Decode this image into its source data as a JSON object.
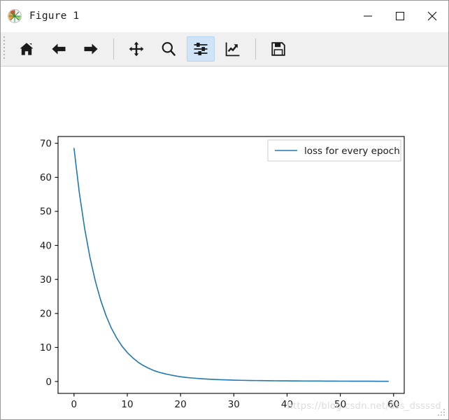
{
  "window": {
    "title": "Figure 1",
    "app_icon": "matplotlib-logo-icon",
    "controls": {
      "minimize": "—",
      "maximize": "□",
      "close": "✕"
    }
  },
  "toolbar": {
    "buttons": [
      {
        "name": "home-icon",
        "tooltip": "Reset original view",
        "active": false
      },
      {
        "name": "arrow-left-icon",
        "tooltip": "Back to previous view",
        "active": false
      },
      {
        "name": "arrow-right-icon",
        "tooltip": "Forward to next view",
        "active": false
      },
      {
        "name": "move-icon",
        "tooltip": "Pan axes with left mouse, zoom with right",
        "active": false
      },
      {
        "name": "magnifier-icon",
        "tooltip": "Zoom to rectangle",
        "active": false
      },
      {
        "name": "sliders-icon",
        "tooltip": "Configure subplots",
        "active": true
      },
      {
        "name": "edit-axis-icon",
        "tooltip": "Edit axis, curve and image parameters",
        "active": false
      },
      {
        "name": "save-disk-icon",
        "tooltip": "Save the figure",
        "active": false
      }
    ]
  },
  "chart_data": {
    "type": "line",
    "title": "",
    "xlabel": "",
    "ylabel": "",
    "xlim": [
      -3,
      62
    ],
    "ylim": [
      -3.5,
      72
    ],
    "xticks": [
      0,
      10,
      20,
      30,
      40,
      50,
      60
    ],
    "yticks": [
      0,
      10,
      20,
      30,
      40,
      50,
      60,
      70
    ],
    "grid": false,
    "legend": {
      "position": "upper right",
      "entries": [
        {
          "label": "loss for every epoch",
          "color": "#1f77b4"
        }
      ]
    },
    "series": [
      {
        "name": "loss for every epoch",
        "color": "#1f77b4",
        "linewidth": 1.6,
        "x": [
          0,
          1,
          2,
          3,
          4,
          5,
          6,
          7,
          8,
          9,
          10,
          11,
          12,
          13,
          14,
          15,
          16,
          17,
          18,
          19,
          20,
          21,
          22,
          23,
          24,
          25,
          26,
          27,
          28,
          29,
          30,
          31,
          32,
          33,
          34,
          35,
          36,
          37,
          38,
          39,
          40,
          41,
          42,
          43,
          44,
          45,
          46,
          47,
          48,
          49,
          50,
          51,
          52,
          53,
          54,
          55,
          56,
          57,
          58,
          59
        ],
        "values": [
          68.5,
          55.4,
          44.9,
          36.4,
          29.5,
          23.9,
          19.4,
          15.7,
          12.8,
          10.4,
          8.5,
          7.0,
          5.7,
          4.7,
          3.9,
          3.2,
          2.7,
          2.3,
          1.95,
          1.65,
          1.4,
          1.2,
          1.05,
          0.92,
          0.8,
          0.7,
          0.62,
          0.55,
          0.49,
          0.44,
          0.4,
          0.36,
          0.33,
          0.3,
          0.28,
          0.26,
          0.24,
          0.22,
          0.2,
          0.19,
          0.18,
          0.17,
          0.16,
          0.15,
          0.14,
          0.13,
          0.13,
          0.12,
          0.11,
          0.11,
          0.1,
          0.1,
          0.09,
          0.09,
          0.08,
          0.08,
          0.08,
          0.07,
          0.07,
          0.07
        ]
      }
    ]
  },
  "watermark": {
    "text": "https://blog.csdn.net/dss_dssssd"
  },
  "colors": {
    "line": "#1f77b4",
    "toolbar_bg": "#f0f0f0",
    "active_btn": "#cfe4f7",
    "axis": "#000000"
  }
}
